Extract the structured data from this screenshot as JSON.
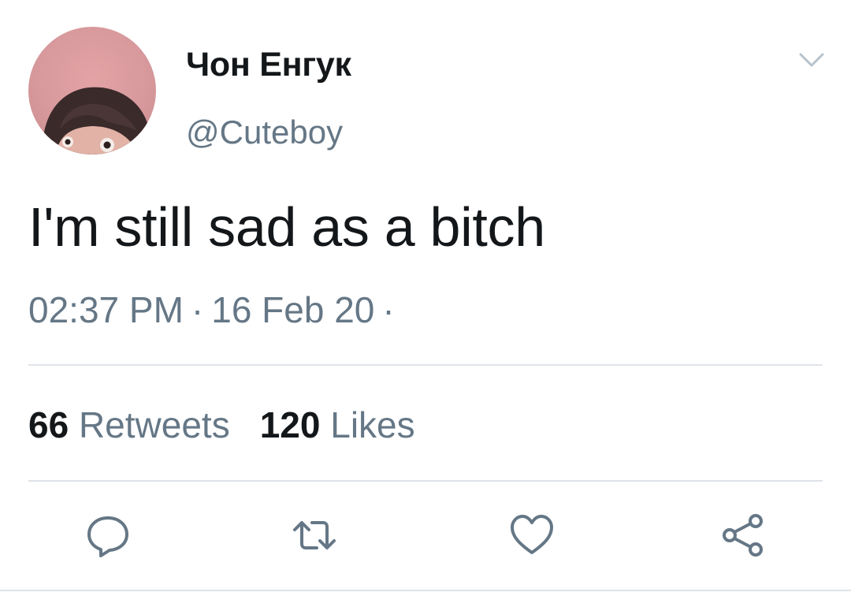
{
  "tweet": {
    "display_name": "Чон Енгук",
    "handle": "@Cuteboy",
    "text": "I'm still sad as a bitch",
    "time": "02:37 PM",
    "date": "16 Feb 20",
    "separator": "·",
    "retweet_count": "66",
    "retweet_label": "Retweets",
    "like_count": "120",
    "like_label": "Likes"
  },
  "icons": {
    "menu": "chevron-down-icon",
    "reply": "reply-icon",
    "retweet": "retweet-icon",
    "like": "heart-icon",
    "share": "share-icon"
  },
  "colors": {
    "text": "#14171a",
    "secondary": "#657786",
    "divider": "#dfe3e8",
    "icon": "#657786"
  }
}
